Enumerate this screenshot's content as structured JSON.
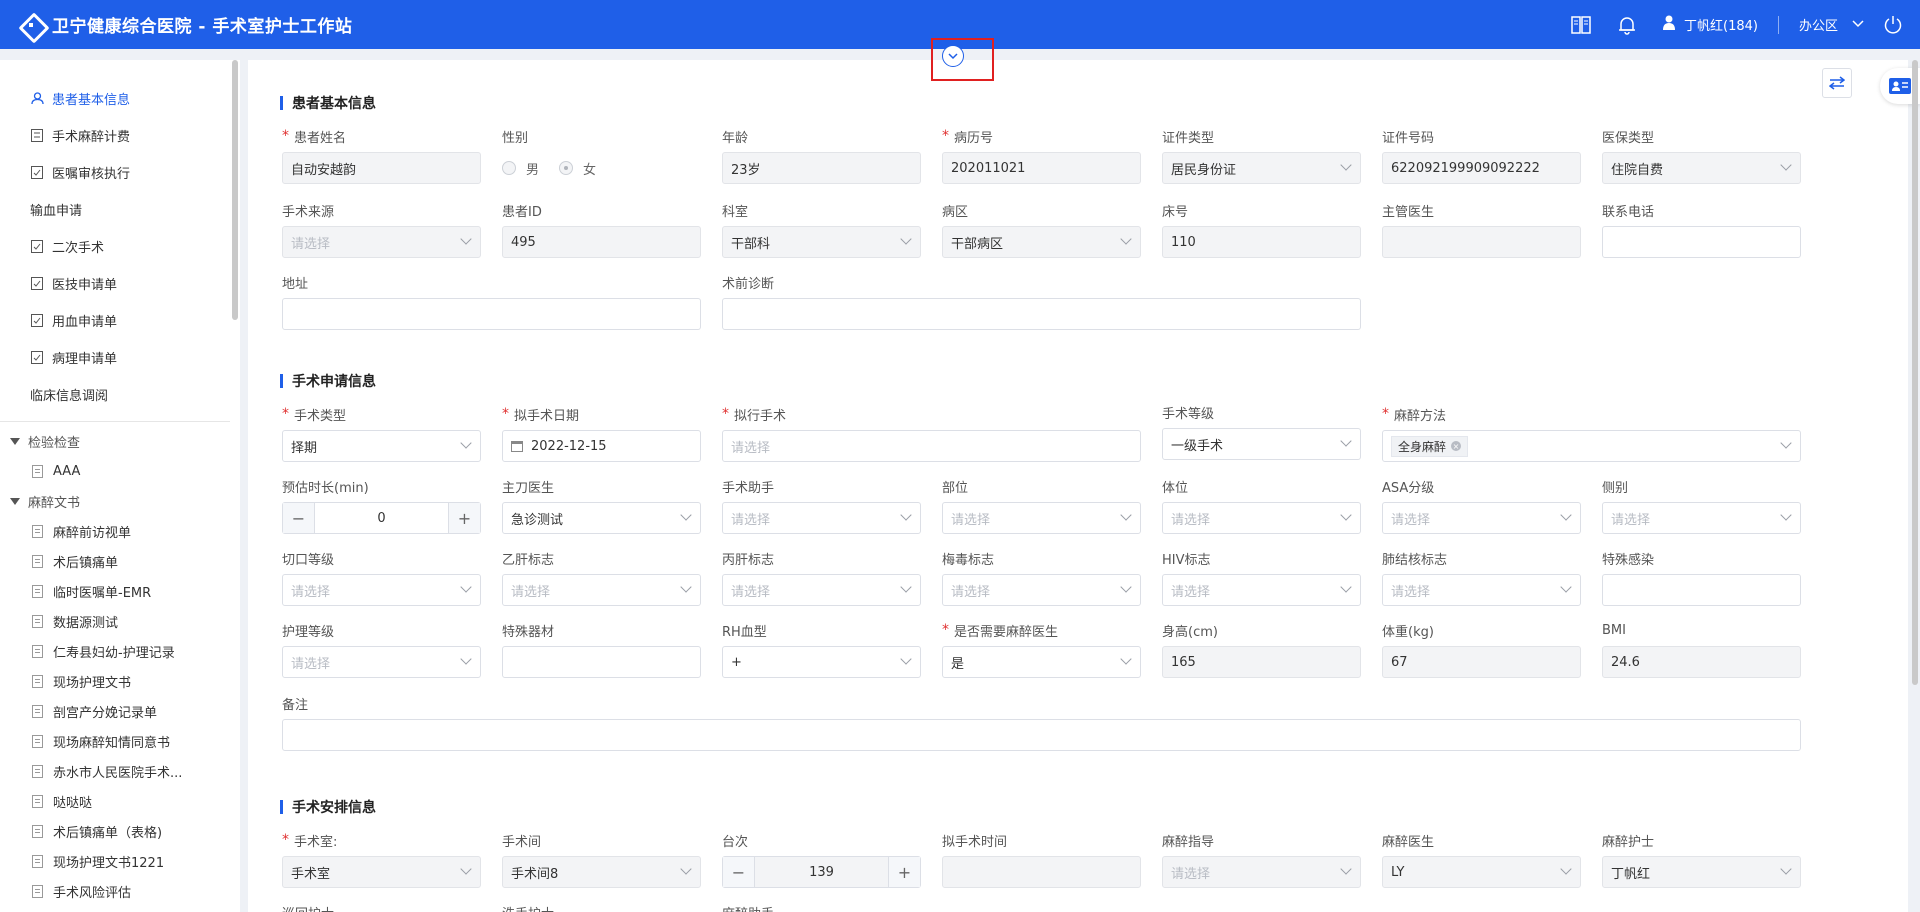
{
  "app": {
    "title": "卫宁健康综合医院 - 手术室护士工作站"
  },
  "topbar": {
    "user": "丁帆红(184)",
    "office": "办公区"
  },
  "sidebar": {
    "nav": [
      {
        "label": "患者基本信息",
        "icon": "user-icon",
        "active": true
      },
      {
        "label": "手术麻醉计费",
        "icon": "calc-icon"
      },
      {
        "label": "医嘱审核执行",
        "icon": "check-doc-icon"
      },
      {
        "label": "输血申请",
        "icon": ""
      },
      {
        "label": "二次手术",
        "icon": "check-doc-icon"
      },
      {
        "label": "医技申请单",
        "icon": "check-doc-icon"
      },
      {
        "label": "用血申请单",
        "icon": "check-doc-icon"
      },
      {
        "label": "病理申请单",
        "icon": "check-doc-icon"
      },
      {
        "label": "临床信息调阅",
        "icon": ""
      }
    ],
    "tree": [
      {
        "group": "检验检查",
        "items": [
          "AAA"
        ]
      },
      {
        "group": "麻醉文书",
        "items": [
          "麻醉前访视单",
          "术后镇痛单",
          "临时医嘱单-EMR",
          "数据源测试",
          "仁寿县妇幼-护理记录",
          "现场护理文书",
          "剖宫产分娩记录单",
          "现场麻醉知情同意书",
          "赤水市人民医院手术...",
          "哒哒哒",
          "术后镇痛单（表格)",
          "现场护理文书1221",
          "手术风险评估"
        ]
      }
    ]
  },
  "sections": {
    "basic": "患者基本信息",
    "apply": "手术申请信息",
    "arrange": "手术安排信息"
  },
  "basic": {
    "name": {
      "label": "患者姓名",
      "value": "自动安越韵"
    },
    "gender": {
      "label": "性别",
      "opt1": "男",
      "opt2": "女"
    },
    "age": {
      "label": "年龄",
      "value": "23岁"
    },
    "record_no": {
      "label": "病历号",
      "value": "202011021"
    },
    "id_type": {
      "label": "证件类型",
      "value": "居民身份证"
    },
    "id_no": {
      "label": "证件号码",
      "value": "622092199909092222"
    },
    "insurance": {
      "label": "医保类型",
      "value": "住院自费"
    },
    "source": {
      "label": "手术来源",
      "placeholder": "请选择"
    },
    "patient_id": {
      "label": "患者ID",
      "value": "495"
    },
    "dept": {
      "label": "科室",
      "value": "干部科"
    },
    "ward": {
      "label": "病区",
      "value": "干部病区"
    },
    "bed": {
      "label": "床号",
      "value": "110"
    },
    "doctor": {
      "label": "主管医生",
      "value": ""
    },
    "phone": {
      "label": "联系电话",
      "value": ""
    },
    "address": {
      "label": "地址",
      "value": ""
    },
    "diagnosis": {
      "label": "术前诊断",
      "value": ""
    }
  },
  "apply": {
    "op_type": {
      "label": "手术类型",
      "value": "择期"
    },
    "op_date": {
      "label": "拟手术日期",
      "value": "2022-12-15"
    },
    "op_name": {
      "label": "拟行手术",
      "placeholder": "请选择"
    },
    "op_level": {
      "label": "手术等级",
      "value": "一级手术"
    },
    "anes": {
      "label": "麻醉方法",
      "tag": "全身麻醉"
    },
    "duration": {
      "label": "预估时长(min)",
      "value": "0"
    },
    "surgeon": {
      "label": "主刀医生",
      "value": "急诊测试"
    },
    "assistant": {
      "label": "手术助手",
      "placeholder": "请选择"
    },
    "site": {
      "label": "部位",
      "placeholder": "请选择"
    },
    "position": {
      "label": "体位",
      "placeholder": "请选择"
    },
    "asa": {
      "label": "ASA分级",
      "placeholder": "请选择"
    },
    "side": {
      "label": "侧别",
      "placeholder": "请选择"
    },
    "incision": {
      "label": "切口等级",
      "placeholder": "请选择"
    },
    "hbv": {
      "label": "乙肝标志",
      "placeholder": "请选择"
    },
    "hcv": {
      "label": "丙肝标志",
      "placeholder": "请选择"
    },
    "syphilis": {
      "label": "梅毒标志",
      "placeholder": "请选择"
    },
    "hiv": {
      "label": "HIV标志",
      "placeholder": "请选择"
    },
    "tb": {
      "label": "肺结核标志",
      "placeholder": "请选择"
    },
    "special_inf": {
      "label": "特殊感染",
      "value": ""
    },
    "nursing": {
      "label": "护理等级",
      "placeholder": "请选择"
    },
    "equipment": {
      "label": "特殊器材",
      "value": ""
    },
    "rh": {
      "label": "RH血型",
      "value": "+"
    },
    "need_anes": {
      "label": "是否需要麻醉医生",
      "value": "是"
    },
    "height": {
      "label": "身高(cm)",
      "value": "165"
    },
    "weight": {
      "label": "体重(kg)",
      "value": "67"
    },
    "bmi": {
      "label": "BMI",
      "value": "24.6"
    },
    "remark": {
      "label": "备注",
      "value": ""
    }
  },
  "arrange": {
    "room": {
      "label": "手术室:",
      "value": "手术室"
    },
    "theatre": {
      "label": "手术间",
      "value": "手术间8"
    },
    "sequence": {
      "label": "台次",
      "value": "139"
    },
    "time": {
      "label": "拟手术时间",
      "value": ""
    },
    "anes_guide": {
      "label": "麻醉指导",
      "placeholder": "请选择"
    },
    "anes_doctor": {
      "label": "麻醉医生",
      "value": "LY"
    },
    "anes_nurse": {
      "label": "麻醉护士",
      "value": "丁帆红"
    },
    "circ_nurse": {
      "label": "巡回护士"
    },
    "scrub_nurse": {
      "label": "洗手护士"
    },
    "anes_assist": {
      "label": "麻醉助手"
    }
  }
}
